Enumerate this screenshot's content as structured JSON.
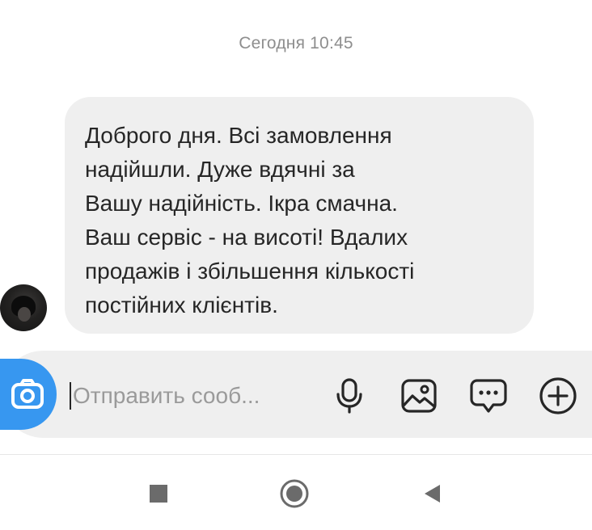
{
  "chat": {
    "timestamp": "Сегодня 10:45",
    "message": {
      "text": "Доброго дня. Всі замовлення\nнадійшли. Дуже вдячні за\nВашу надійність. Ікра смачна.\nВаш сервіс - на висоті! Вдалих\nпродажів і збільшення кількості\nпостійних клієнтів."
    }
  },
  "composer": {
    "placeholder": "Отправить сооб...",
    "buttons": {
      "camera": "camera-icon",
      "microphone": "microphone-icon",
      "gallery": "image-icon",
      "sticker": "chat-bubble-icon",
      "more": "plus-circle-icon"
    }
  },
  "navigation": {
    "buttons": [
      "recent-apps-icon",
      "home-icon",
      "back-icon"
    ]
  },
  "colors": {
    "accent": "#3797f0",
    "bubble": "#efefef",
    "text": "#262626",
    "muted": "#8e8e8e"
  }
}
